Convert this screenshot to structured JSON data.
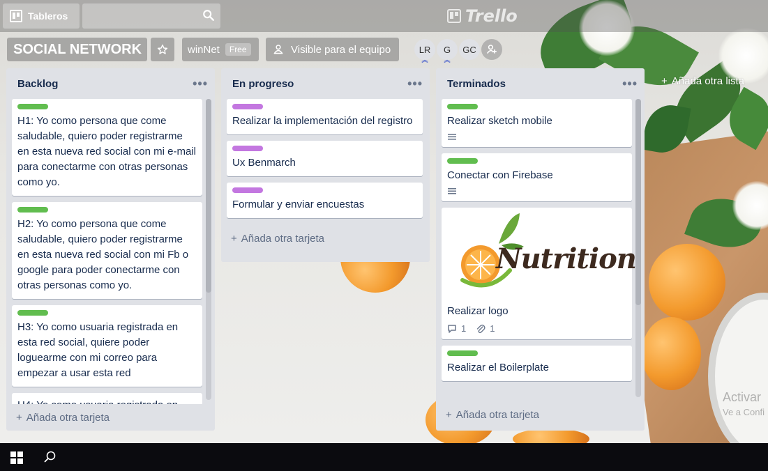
{
  "header": {
    "boards_label": "Tableros",
    "search_placeholder": "",
    "logo_text": "Trello"
  },
  "board": {
    "title": "SOCIAL NETWORK",
    "team_name": "winNet",
    "team_badge": "Free",
    "visibility_label": "Visible para el equipo",
    "members": [
      "LR",
      "G",
      "GC"
    ],
    "add_list_label": "Añada otra lista"
  },
  "lists": [
    {
      "title": "Backlog",
      "add_card_label": "Añada otra tarjeta",
      "cards": [
        {
          "label": "green",
          "text": "H1: Yo como persona que come saludable, quiero poder registrarme en esta nueva red social con mi e-mail para conectarme con otras personas como yo."
        },
        {
          "label": "green",
          "text": "H2: Yo como persona que come saludable, quiero poder registrarme en esta nueva red social con mi Fb o google para poder conectarme con otras personas como yo."
        },
        {
          "label": "green",
          "text": "H3: Yo como usuaria registrada en esta red social, quiere poder loguearme con mi correo para empezar a usar esta red"
        },
        {
          "label": "",
          "text": "H4: Yo como usuaria registrada en"
        }
      ]
    },
    {
      "title": "En progreso",
      "add_card_label": "Añada otra tarjeta",
      "cards": [
        {
          "label": "purple",
          "text": "Realizar la implementación del registro"
        },
        {
          "label": "purple",
          "text": "Ux Benmarch"
        },
        {
          "label": "purple",
          "text": "Formular y enviar encuestas"
        }
      ]
    },
    {
      "title": "Terminados",
      "add_card_label": "Añada otra tarjeta",
      "cards": [
        {
          "label": "green",
          "text": "Realizar sketch mobile"
        },
        {
          "label": "green",
          "text": "Conectar con Firebase"
        },
        {
          "label": "",
          "image_text": "Nutrition",
          "text": "Realizar logo",
          "comments": "1",
          "attachments": "1"
        },
        {
          "label": "green",
          "text": "Realizar el Boilerplate"
        }
      ]
    }
  ],
  "os": {
    "activate_title": "Activar",
    "activate_sub": "Ve a Confi"
  },
  "colors": {
    "green_label": "#61bd4f",
    "purple_label": "#c377e0",
    "list_bg": "#dfe1e6",
    "text_dark": "#172b4d"
  }
}
